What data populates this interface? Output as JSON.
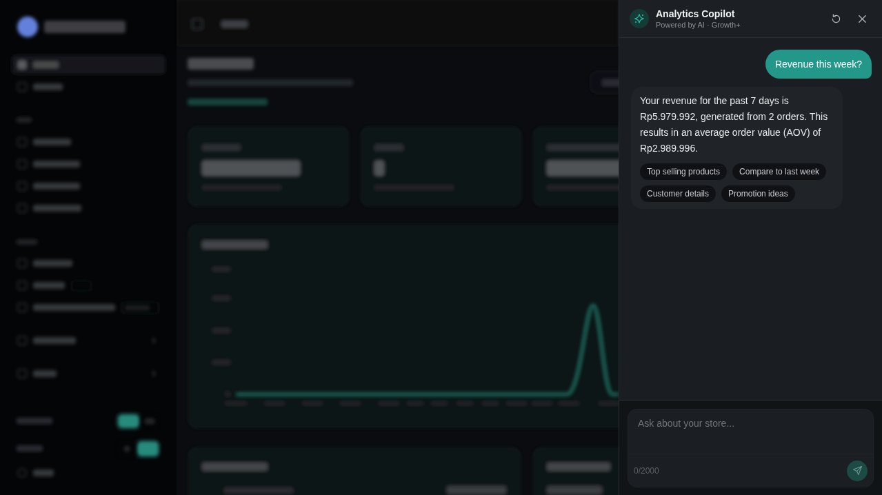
{
  "copilot": {
    "title": "Analytics Copilot",
    "subtitle": "Powered by AI · Growth+",
    "messages": [
      {
        "kind": "user",
        "text": "Revenue this week?"
      },
      {
        "kind": "assistant",
        "text": "Your revenue for the past 7 days is Rp5.979.992, generated from 2 orders. This results in an average order value (AOV) of Rp2.989.996.",
        "suggestions": [
          "Top selling products",
          "Compare to last week",
          "Customer details",
          "Promotion ideas"
        ]
      }
    ],
    "composer": {
      "placeholder": "Ask about your store...",
      "counter": "0/2000",
      "send_disabled": true
    }
  }
}
